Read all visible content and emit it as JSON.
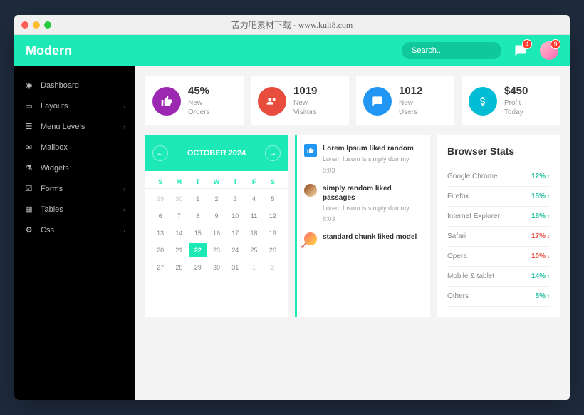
{
  "window_title": "苦力吧素材下载 - www.kuli8.com",
  "brand": "Modern",
  "search_placeholder": "Search...",
  "notif_count": "4",
  "avatar_badge": "9",
  "sidebar": [
    {
      "icon": "dashboard",
      "label": "Dashboard",
      "chev": false
    },
    {
      "icon": "layouts",
      "label": "Layouts",
      "chev": true
    },
    {
      "icon": "menu",
      "label": "Menu Levels",
      "chev": true
    },
    {
      "icon": "mail",
      "label": "Mailbox",
      "chev": false
    },
    {
      "icon": "widget",
      "label": "Widgets",
      "chev": false
    },
    {
      "icon": "forms",
      "label": "Forms",
      "chev": true
    },
    {
      "icon": "tables",
      "label": "Tables",
      "chev": true
    },
    {
      "icon": "css",
      "label": "Css",
      "chev": true
    }
  ],
  "stats": [
    {
      "value": "45%",
      "line1": "New",
      "line2": "Orders"
    },
    {
      "value": "1019",
      "line1": "New",
      "line2": "Visitors"
    },
    {
      "value": "1012",
      "line1": "New",
      "line2": "Users"
    },
    {
      "value": "$450",
      "line1": "Profit",
      "line2": "Today"
    }
  ],
  "calendar": {
    "title": "OCTOBER 2024",
    "days": [
      "S",
      "M",
      "T",
      "W",
      "T",
      "F",
      "S"
    ],
    "cells": [
      {
        "n": "29",
        "dim": true
      },
      {
        "n": "30",
        "dim": true
      },
      {
        "n": "1"
      },
      {
        "n": "2"
      },
      {
        "n": "3"
      },
      {
        "n": "4"
      },
      {
        "n": "5"
      },
      {
        "n": "6"
      },
      {
        "n": "7"
      },
      {
        "n": "8"
      },
      {
        "n": "9"
      },
      {
        "n": "10"
      },
      {
        "n": "11"
      },
      {
        "n": "12"
      },
      {
        "n": "13"
      },
      {
        "n": "14"
      },
      {
        "n": "15"
      },
      {
        "n": "16"
      },
      {
        "n": "17"
      },
      {
        "n": "18"
      },
      {
        "n": "19"
      },
      {
        "n": "20"
      },
      {
        "n": "21"
      },
      {
        "n": "22",
        "today": true
      },
      {
        "n": "23"
      },
      {
        "n": "24"
      },
      {
        "n": "25"
      },
      {
        "n": "26"
      },
      {
        "n": "27"
      },
      {
        "n": "28"
      },
      {
        "n": "29"
      },
      {
        "n": "30"
      },
      {
        "n": "31"
      },
      {
        "n": "1",
        "dim": true
      },
      {
        "n": "2",
        "dim": true
      }
    ]
  },
  "feed": [
    {
      "type": "thumb",
      "title": "Lorem Ipsum liked random",
      "desc": "Lorem Ipsum is simply dummy",
      "time": "8:03"
    },
    {
      "type": "avatar",
      "title": "simply random liked passages",
      "desc": "Lorem Ipsum is simply dummy",
      "time": "8:03"
    },
    {
      "type": "check",
      "title": "standard chunk liked model",
      "desc": "",
      "time": ""
    }
  ],
  "browser_stats": {
    "title": "Browser Stats",
    "rows": [
      {
        "name": "Google Chrome",
        "pct": "12%",
        "dir": "up"
      },
      {
        "name": "Firefox",
        "pct": "15%",
        "dir": "up"
      },
      {
        "name": "Internet Explorer",
        "pct": "18%",
        "dir": "up"
      },
      {
        "name": "Safari",
        "pct": "17%",
        "dir": "down"
      },
      {
        "name": "Opera",
        "pct": "10%",
        "dir": "down"
      },
      {
        "name": "Mobile & tablet",
        "pct": "14%",
        "dir": "up"
      },
      {
        "name": "Others",
        "pct": "5%",
        "dir": "up"
      }
    ]
  }
}
